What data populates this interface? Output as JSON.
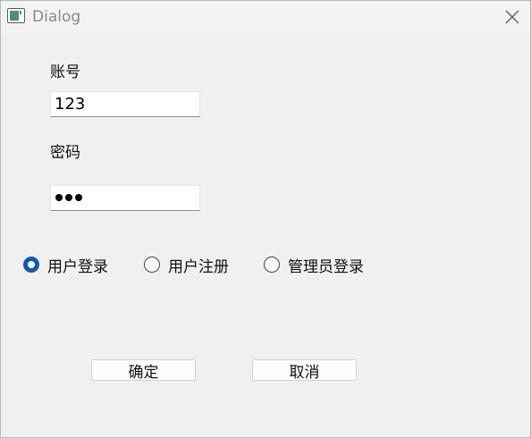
{
  "window": {
    "title": "Dialog"
  },
  "form": {
    "account_label": "账号",
    "account_value": "123",
    "password_label": "密码",
    "password_mask_count": 3
  },
  "roles": [
    {
      "label": "用户登录",
      "checked": true
    },
    {
      "label": "用户注册",
      "checked": false
    },
    {
      "label": "管理员登录",
      "checked": false
    }
  ],
  "buttons": {
    "ok_label": "确定",
    "cancel_label": "取消"
  },
  "colors": {
    "accent": "#0b5cad"
  },
  "icons": {
    "app": "window-app-icon",
    "close": "close-icon"
  }
}
